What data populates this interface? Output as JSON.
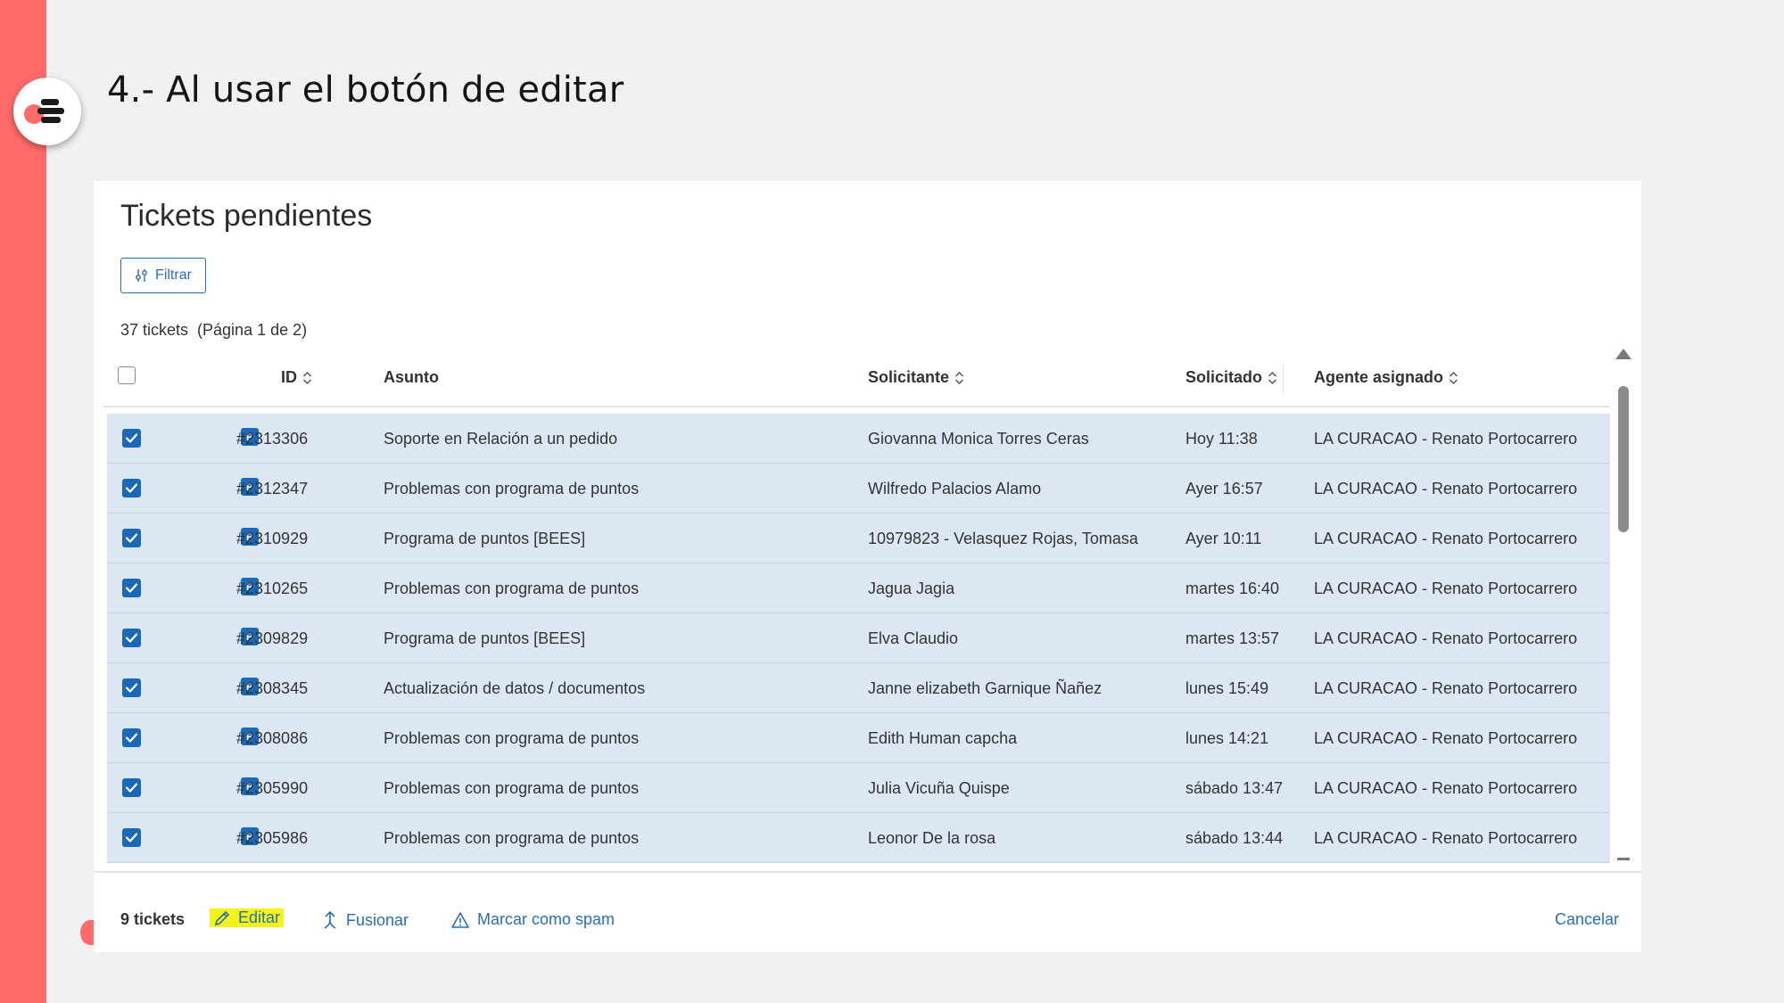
{
  "slide": {
    "title": "4.- Al usar el botón de editar"
  },
  "panel": {
    "title": "Tickets pendientes",
    "filter_label": "Filtrar",
    "count_line": "37 tickets  (Página 1 de 2)"
  },
  "table": {
    "headers": {
      "id": "ID",
      "subject": "Asunto",
      "requester": "Solicitante",
      "requested": "Solicitado",
      "agent": "Agente asignado"
    },
    "type_badge": "P",
    "rows": [
      {
        "id": "#2313306",
        "subject": "Soporte en Relación a un pedido",
        "requester": "Giovanna Monica Torres Ceras",
        "requested": "Hoy 11:38",
        "agent": "LA CURACAO - Renato Portocarrero"
      },
      {
        "id": "#2312347",
        "subject": "Problemas con programa de puntos",
        "requester": "Wilfredo Palacios Alamo",
        "requested": "Ayer 16:57",
        "agent": "LA CURACAO - Renato Portocarrero"
      },
      {
        "id": "#2310929",
        "subject": "Programa de puntos [BEES]",
        "requester": "10979823 - Velasquez Rojas, Tomasa",
        "requested": "Ayer 10:11",
        "agent": "LA CURACAO - Renato Portocarrero"
      },
      {
        "id": "#2310265",
        "subject": "Problemas con programa de puntos",
        "requester": "Jagua Jagia",
        "requested": "martes 16:40",
        "agent": "LA CURACAO - Renato Portocarrero"
      },
      {
        "id": "#2309829",
        "subject": "Programa de puntos [BEES]",
        "requester": "Elva Claudio",
        "requested": "martes 13:57",
        "agent": "LA CURACAO - Renato Portocarrero"
      },
      {
        "id": "#2308345",
        "subject": "Actualización de datos / documentos",
        "requester": "Janne elizabeth Garnique Ñañez",
        "requested": "lunes 15:49",
        "agent": "LA CURACAO - Renato Portocarrero"
      },
      {
        "id": "#2308086",
        "subject": "Problemas con programa de puntos",
        "requester": "Edith Human capcha",
        "requested": "lunes 14:21",
        "agent": "LA CURACAO - Renato Portocarrero"
      },
      {
        "id": "#2305990",
        "subject": "Problemas con programa de puntos",
        "requester": "Julia Vicuña Quispe",
        "requested": "sábado 13:47",
        "agent": "LA CURACAO - Renato Portocarrero"
      },
      {
        "id": "#2305986",
        "subject": "Problemas con programa de puntos",
        "requester": "Leonor De la rosa",
        "requested": "sábado 13:44",
        "agent": "LA CURACAO - Renato Portocarrero"
      }
    ]
  },
  "footer": {
    "selected_count": "9 tickets",
    "edit": "Editar",
    "merge": "Fusionar",
    "spam": "Marcar como spam",
    "cancel": "Cancelar"
  },
  "colors": {
    "accent": "#2a6db5",
    "row_selected": "#dde7f3",
    "checkbox": "#1a68b8",
    "highlight": "#f3f316",
    "stripe": "#ff6b6b"
  }
}
